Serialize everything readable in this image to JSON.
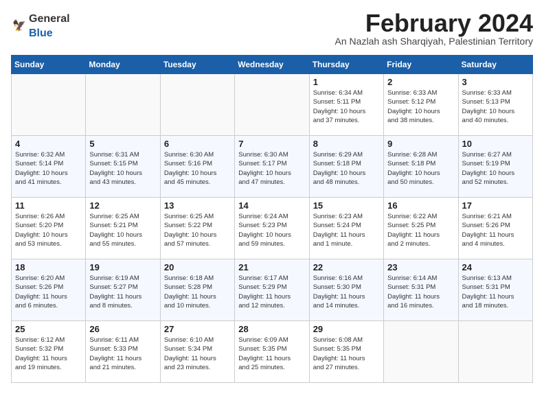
{
  "header": {
    "logo_general": "General",
    "logo_blue": "Blue",
    "month_title": "February 2024",
    "subtitle": "An Nazlah ash Sharqiyah, Palestinian Territory"
  },
  "days_of_week": [
    "Sunday",
    "Monday",
    "Tuesday",
    "Wednesday",
    "Thursday",
    "Friday",
    "Saturday"
  ],
  "weeks": [
    [
      {
        "day": "",
        "info": ""
      },
      {
        "day": "",
        "info": ""
      },
      {
        "day": "",
        "info": ""
      },
      {
        "day": "",
        "info": ""
      },
      {
        "day": "1",
        "info": "Sunrise: 6:34 AM\nSunset: 5:11 PM\nDaylight: 10 hours\nand 37 minutes."
      },
      {
        "day": "2",
        "info": "Sunrise: 6:33 AM\nSunset: 5:12 PM\nDaylight: 10 hours\nand 38 minutes."
      },
      {
        "day": "3",
        "info": "Sunrise: 6:33 AM\nSunset: 5:13 PM\nDaylight: 10 hours\nand 40 minutes."
      }
    ],
    [
      {
        "day": "4",
        "info": "Sunrise: 6:32 AM\nSunset: 5:14 PM\nDaylight: 10 hours\nand 41 minutes."
      },
      {
        "day": "5",
        "info": "Sunrise: 6:31 AM\nSunset: 5:15 PM\nDaylight: 10 hours\nand 43 minutes."
      },
      {
        "day": "6",
        "info": "Sunrise: 6:30 AM\nSunset: 5:16 PM\nDaylight: 10 hours\nand 45 minutes."
      },
      {
        "day": "7",
        "info": "Sunrise: 6:30 AM\nSunset: 5:17 PM\nDaylight: 10 hours\nand 47 minutes."
      },
      {
        "day": "8",
        "info": "Sunrise: 6:29 AM\nSunset: 5:18 PM\nDaylight: 10 hours\nand 48 minutes."
      },
      {
        "day": "9",
        "info": "Sunrise: 6:28 AM\nSunset: 5:18 PM\nDaylight: 10 hours\nand 50 minutes."
      },
      {
        "day": "10",
        "info": "Sunrise: 6:27 AM\nSunset: 5:19 PM\nDaylight: 10 hours\nand 52 minutes."
      }
    ],
    [
      {
        "day": "11",
        "info": "Sunrise: 6:26 AM\nSunset: 5:20 PM\nDaylight: 10 hours\nand 53 minutes."
      },
      {
        "day": "12",
        "info": "Sunrise: 6:25 AM\nSunset: 5:21 PM\nDaylight: 10 hours\nand 55 minutes."
      },
      {
        "day": "13",
        "info": "Sunrise: 6:25 AM\nSunset: 5:22 PM\nDaylight: 10 hours\nand 57 minutes."
      },
      {
        "day": "14",
        "info": "Sunrise: 6:24 AM\nSunset: 5:23 PM\nDaylight: 10 hours\nand 59 minutes."
      },
      {
        "day": "15",
        "info": "Sunrise: 6:23 AM\nSunset: 5:24 PM\nDaylight: 11 hours\nand 1 minute."
      },
      {
        "day": "16",
        "info": "Sunrise: 6:22 AM\nSunset: 5:25 PM\nDaylight: 11 hours\nand 2 minutes."
      },
      {
        "day": "17",
        "info": "Sunrise: 6:21 AM\nSunset: 5:26 PM\nDaylight: 11 hours\nand 4 minutes."
      }
    ],
    [
      {
        "day": "18",
        "info": "Sunrise: 6:20 AM\nSunset: 5:26 PM\nDaylight: 11 hours\nand 6 minutes."
      },
      {
        "day": "19",
        "info": "Sunrise: 6:19 AM\nSunset: 5:27 PM\nDaylight: 11 hours\nand 8 minutes."
      },
      {
        "day": "20",
        "info": "Sunrise: 6:18 AM\nSunset: 5:28 PM\nDaylight: 11 hours\nand 10 minutes."
      },
      {
        "day": "21",
        "info": "Sunrise: 6:17 AM\nSunset: 5:29 PM\nDaylight: 11 hours\nand 12 minutes."
      },
      {
        "day": "22",
        "info": "Sunrise: 6:16 AM\nSunset: 5:30 PM\nDaylight: 11 hours\nand 14 minutes."
      },
      {
        "day": "23",
        "info": "Sunrise: 6:14 AM\nSunset: 5:31 PM\nDaylight: 11 hours\nand 16 minutes."
      },
      {
        "day": "24",
        "info": "Sunrise: 6:13 AM\nSunset: 5:31 PM\nDaylight: 11 hours\nand 18 minutes."
      }
    ],
    [
      {
        "day": "25",
        "info": "Sunrise: 6:12 AM\nSunset: 5:32 PM\nDaylight: 11 hours\nand 19 minutes."
      },
      {
        "day": "26",
        "info": "Sunrise: 6:11 AM\nSunset: 5:33 PM\nDaylight: 11 hours\nand 21 minutes."
      },
      {
        "day": "27",
        "info": "Sunrise: 6:10 AM\nSunset: 5:34 PM\nDaylight: 11 hours\nand 23 minutes."
      },
      {
        "day": "28",
        "info": "Sunrise: 6:09 AM\nSunset: 5:35 PM\nDaylight: 11 hours\nand 25 minutes."
      },
      {
        "day": "29",
        "info": "Sunrise: 6:08 AM\nSunset: 5:35 PM\nDaylight: 11 hours\nand 27 minutes."
      },
      {
        "day": "",
        "info": ""
      },
      {
        "day": "",
        "info": ""
      }
    ]
  ]
}
